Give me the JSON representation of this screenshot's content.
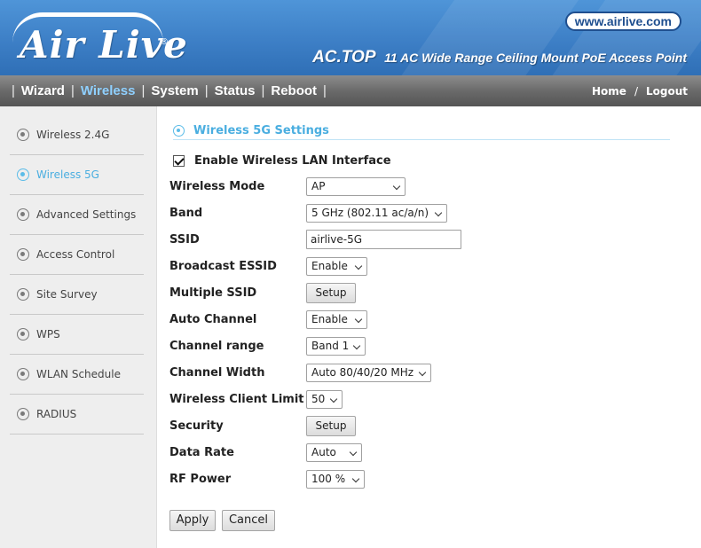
{
  "header": {
    "logo_text": "Air Live",
    "logo_mark": "®",
    "site_link": "www.airlive.com",
    "model": "AC.TOP",
    "description": "11 AC Wide Range Ceiling Mount PoE Access Point",
    "colors": {
      "header_blue": "#3d7fc6",
      "nav_gray": "#6a6a6a",
      "accent": "#4aaee0"
    }
  },
  "nav": {
    "items": [
      {
        "label": "Wizard",
        "active": false
      },
      {
        "label": "Wireless",
        "active": true
      },
      {
        "label": "System",
        "active": false
      },
      {
        "label": "Status",
        "active": false
      },
      {
        "label": "Reboot",
        "active": false
      }
    ],
    "separator": "|",
    "home": "Home",
    "slash": "/",
    "logout": "Logout"
  },
  "sidebar": {
    "items": [
      {
        "label": "Wireless 2.4G",
        "icon": "radio-bullet-icon",
        "active": false
      },
      {
        "label": "Wireless 5G",
        "icon": "radio-bullet-icon",
        "active": true
      },
      {
        "label": "Advanced Settings",
        "icon": "radio-bullet-icon",
        "active": false
      },
      {
        "label": "Access Control",
        "icon": "radio-bullet-icon",
        "active": false
      },
      {
        "label": "Site Survey",
        "icon": "radio-bullet-icon",
        "active": false
      },
      {
        "label": "WPS",
        "icon": "radio-bullet-icon",
        "active": false
      },
      {
        "label": "WLAN Schedule",
        "icon": "radio-bullet-icon",
        "active": false
      },
      {
        "label": "RADIUS",
        "icon": "radio-bullet-icon",
        "active": false
      }
    ]
  },
  "main": {
    "section_title": "Wireless 5G Settings",
    "enable_label": "Enable Wireless LAN Interface",
    "enable_checked": true,
    "fields": {
      "wireless_mode": {
        "label": "Wireless Mode",
        "value": "AP"
      },
      "band": {
        "label": "Band",
        "value": "5 GHz (802.11 ac/a/n)"
      },
      "ssid": {
        "label": "SSID",
        "value": "airlive-5G"
      },
      "broadcast_essid": {
        "label": "Broadcast ESSID",
        "value": "Enable"
      },
      "multiple_ssid": {
        "label": "Multiple SSID",
        "button": "Setup"
      },
      "auto_channel": {
        "label": "Auto Channel",
        "value": "Enable"
      },
      "channel_range": {
        "label": "Channel range",
        "value": "Band 1"
      },
      "channel_width": {
        "label": "Channel Width",
        "value": "Auto 80/40/20 MHz"
      },
      "client_limit": {
        "label": "Wireless Client Limit",
        "value": "50"
      },
      "security": {
        "label": "Security",
        "button": "Setup"
      },
      "data_rate": {
        "label": "Data Rate",
        "value": "Auto"
      },
      "rf_power": {
        "label": "RF Power",
        "value": "100 %"
      }
    },
    "apply": "Apply",
    "cancel": "Cancel"
  }
}
